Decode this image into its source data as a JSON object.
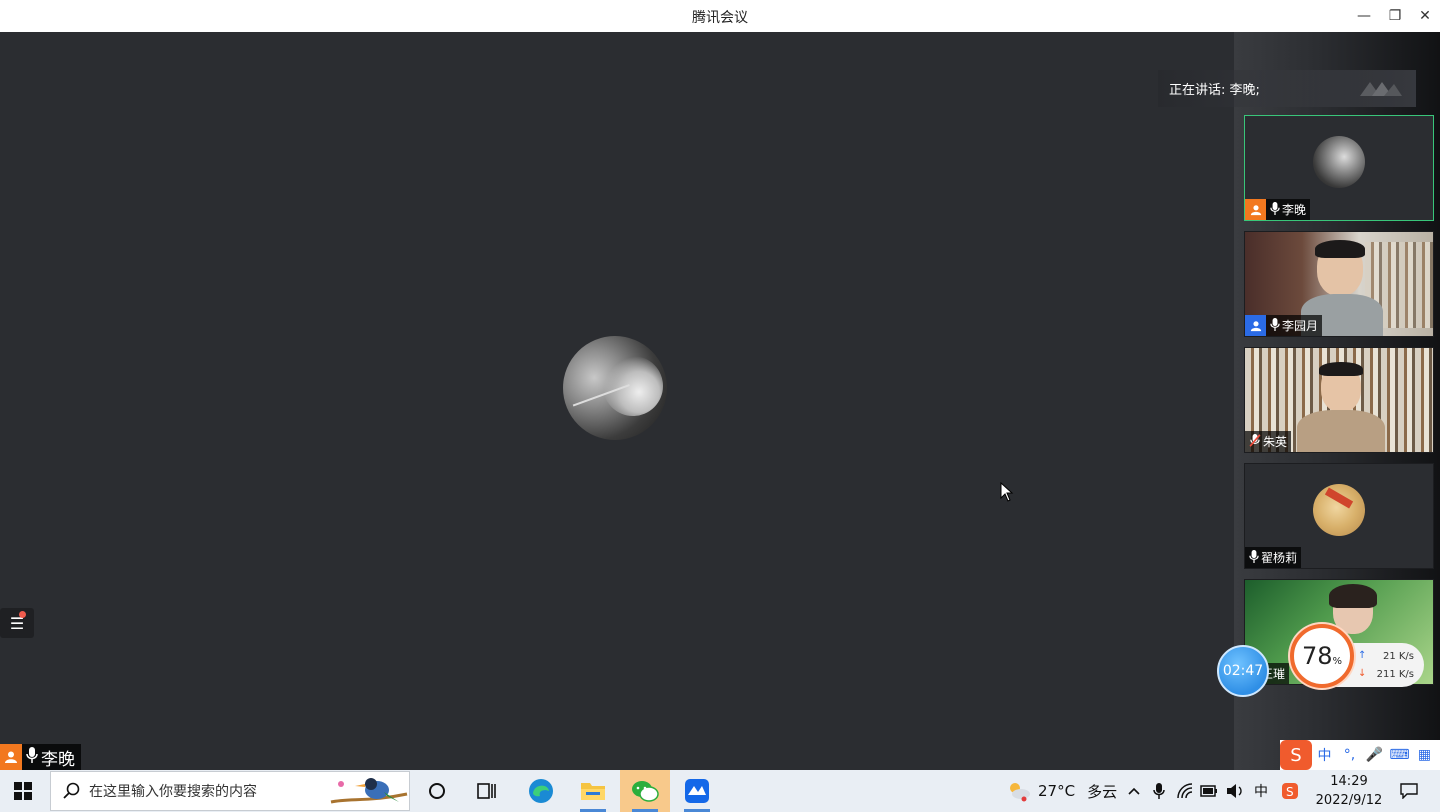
{
  "window": {
    "title": "腾讯会议",
    "minimize_glyph": "—",
    "restore_glyph": "❐",
    "close_glyph": "✕"
  },
  "meeting": {
    "speaking_text": "正在讲话: 李晚;",
    "main_participant": "李晚",
    "participants": [
      {
        "name": "李晚",
        "badge": "host",
        "muted": false
      },
      {
        "name": "李园月",
        "badge": "cohost",
        "muted": false
      },
      {
        "name": "朱英",
        "badge": "",
        "muted": true
      },
      {
        "name": "翟杨莉",
        "badge": "",
        "muted": false
      },
      {
        "name": "王璀",
        "badge": "",
        "muted": false
      }
    ]
  },
  "overlay": {
    "timer": "02:47",
    "gauge_value": "78",
    "gauge_unit": "%",
    "upload": "21 K/s",
    "download": "211 K/s"
  },
  "ime": {
    "logo": "S",
    "mode": "中",
    "punct": "°,",
    "mic": "🎤",
    "keyboard": "⌨",
    "grid": "▦"
  },
  "taskbar": {
    "search_placeholder": "在这里输入你要搜索的内容",
    "weather_temp": "27°C",
    "weather_desc": "多云",
    "tray_ime": "中",
    "time": "14:29",
    "date": "2022/9/12"
  },
  "colors": {
    "accent_green": "#39c67a",
    "host_orange": "#f2781f",
    "cohost_blue": "#2b6be6",
    "stage_bg": "#2b2d31"
  }
}
